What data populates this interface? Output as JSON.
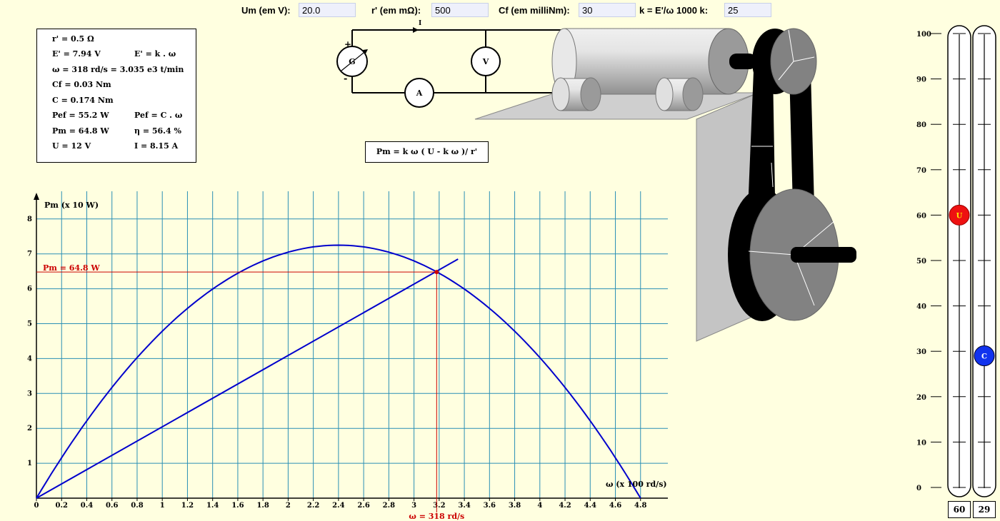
{
  "controls": {
    "um": {
      "label": "Um (em V):",
      "value": "20.0"
    },
    "r": {
      "label": "r' (em mΩ):",
      "value": "500"
    },
    "cf": {
      "label": "Cf (em milliNm):",
      "value": "30"
    },
    "k": {
      "label": "k = E'/ω   1000 k:",
      "value": "25"
    }
  },
  "info": {
    "r": "r' = 0.5 Ω",
    "e": "E' = 7.94 V",
    "e_formula": "E' = k . ω",
    "omega": "ω = 318 rd/s = 3.035 e3 t/min",
    "cf": "Cf = 0.03 Nm",
    "c": "C = 0.174 Nm",
    "pef": "Pef = 55.2 W",
    "pef_formula": "Pef = C . ω",
    "pm": "Pm = 64.8 W",
    "eta": "η = 56.4 %",
    "u": "U = 12 V",
    "i": "I = 8.15 A"
  },
  "formula": "Pm = k ω ( U - k ω )/ r'",
  "circuit": {
    "generator": "G",
    "voltmeter": "V",
    "ammeter": "A",
    "plus": "+",
    "minus": "-",
    "current_label": "I"
  },
  "chart_data": {
    "type": "line",
    "ylabel": "Pm (x 10 W)",
    "xlabel": "ω (x 100 rd/s)",
    "x_ticks": [
      "0",
      "0.2",
      "0.4",
      "0.6",
      "0.8",
      "1",
      "1.2",
      "1.4",
      "1.6",
      "1.8",
      "2",
      "2.2",
      "2.4",
      "2.6",
      "2.8",
      "3",
      "3.2",
      "3.4",
      "3.6",
      "3.8",
      "4",
      "4.2",
      "4.4",
      "4.6",
      "4.8"
    ],
    "y_ticks": [
      "1",
      "2",
      "3",
      "4",
      "5",
      "6",
      "7",
      "8"
    ],
    "xlim": [
      0,
      5
    ],
    "ylim": [
      0,
      8.3
    ],
    "series": [
      {
        "x": [
          0,
          0.4,
          0.8,
          1.2,
          1.6,
          2.0,
          2.4,
          2.8,
          3.2,
          3.6,
          4.0,
          4.4,
          4.8
        ],
        "y": [
          0,
          2.2,
          4.1,
          5.6,
          6.6,
          7.1,
          7.25,
          7.0,
          6.4,
          5.3,
          3.8,
          2.1,
          0
        ],
        "color": "#0000cc"
      },
      {
        "x": [
          0,
          3.35
        ],
        "y": [
          0,
          6.85
        ],
        "color": "#0000cc"
      }
    ],
    "marker": {
      "x": 3.18,
      "y": 6.48,
      "color": "#cc0000"
    },
    "marker_label": "Pm = 64.8 W",
    "x_marker_label": "ω = 318 rd/s"
  },
  "gauges": {
    "ticks": [
      "100",
      "90",
      "80",
      "70",
      "60",
      "50",
      "40",
      "30",
      "20",
      "10",
      "0"
    ],
    "u": {
      "badge": "U",
      "level": 60,
      "value": "60",
      "color": "#ee1111"
    },
    "c": {
      "badge": "C",
      "level": 29,
      "value": "29",
      "color": "#1133ee"
    }
  }
}
